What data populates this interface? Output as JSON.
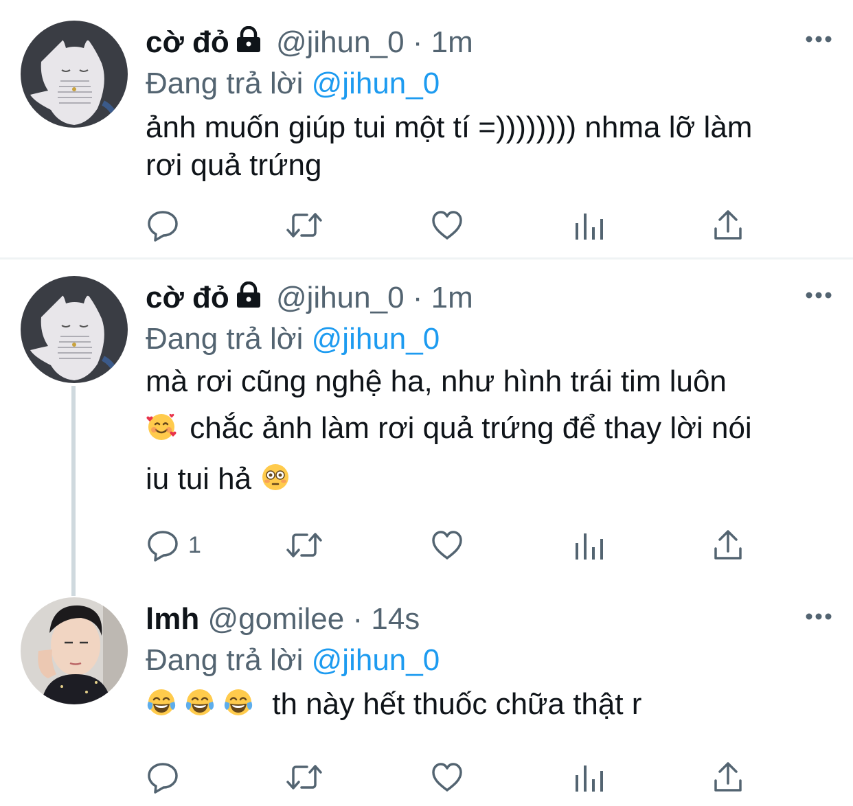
{
  "tweets": [
    {
      "author_name": "cờ đỏ",
      "handle": "@jihun_0",
      "separator": "·",
      "time": "1m",
      "replying_prefix": "Đang trả lời",
      "replying_to": "@jihun_0",
      "text_lines": [
        "ảnh muốn giúp tui một tí =)))))))) nhma lỡ làm",
        "rơi quả trứng"
      ],
      "locked": true,
      "avatar": "white-cat-avatar",
      "reply_count": ""
    },
    {
      "author_name": "cờ đỏ",
      "handle": "@jihun_0",
      "separator": "·",
      "time": "1m",
      "replying_prefix": "Đang trả lời",
      "replying_to": "@jihun_0",
      "text_line1": "mà rơi cũng nghệ ha, như hình trái tim luôn",
      "text_line2": "chắc ảnh làm rơi quả trứng để thay lời nói",
      "text_line3": "iu tui hả",
      "emojis": [
        "smiling-face-with-hearts-emoji",
        "flushed-face-emoji"
      ],
      "locked": true,
      "avatar": "white-cat-avatar",
      "reply_count": "1"
    },
    {
      "author_name": "lmh",
      "handle": "@gomilee",
      "separator": "·",
      "time": "14s",
      "replying_prefix": "Đang trả lời",
      "replying_to": "@jihun_0",
      "text": "th này hết thuốc chữa thật r",
      "emojis": [
        "tears-of-joy-emoji",
        "tears-of-joy-emoji",
        "tears-of-joy-emoji"
      ],
      "locked": false,
      "avatar": "user-photo-avatar",
      "reply_count": ""
    }
  ],
  "icons": [
    "reply-icon",
    "retweet-icon",
    "like-icon",
    "analytics-icon",
    "share-icon",
    "more-icon",
    "lock-icon"
  ],
  "colors": {
    "link": "#1d9bf0",
    "secondary": "#536471",
    "text": "#0f1419",
    "icon": "#536471"
  }
}
